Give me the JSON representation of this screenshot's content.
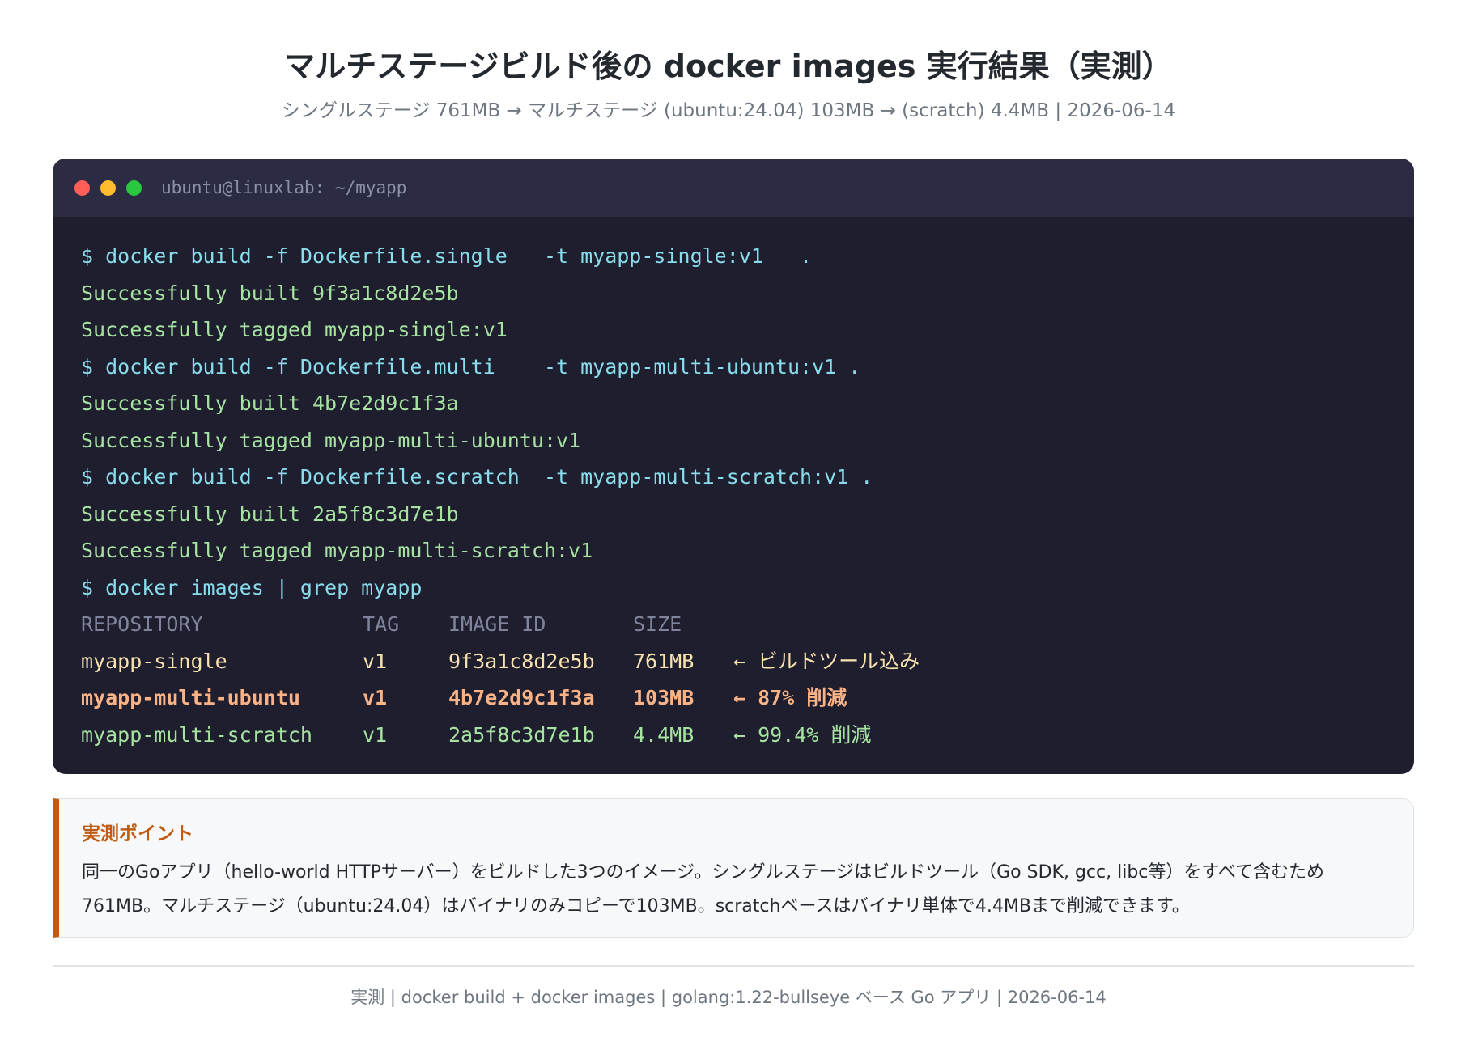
{
  "header": {
    "title": "マルチステージビルド後の docker images 実行結果（実測）",
    "subtitle": "シングルステージ 761MB → マルチステージ (ubuntu:24.04) 103MB → (scratch) 4.4MB | 2026-06-14"
  },
  "terminal": {
    "title": "ubuntu@linuxlab: ~/myapp",
    "colors": {
      "background": "#1e1e2e",
      "titlebar": "#2b2c44",
      "command": "#89dceb",
      "success": "#a6e3a1",
      "header": "#7f849c",
      "single_row": "#f9e2af",
      "ubuntu_row": "#fab387",
      "scratch_row": "#a6e3a1"
    },
    "lines": [
      "$ docker build -f Dockerfile.single   -t myapp-single:v1   .",
      "Successfully built 9f3a1c8d2e5b",
      "Successfully tagged myapp-single:v1",
      "$ docker build -f Dockerfile.multi    -t myapp-multi-ubuntu:v1 .",
      "Successfully built 4b7e2d9c1f3a",
      "Successfully tagged myapp-multi-ubuntu:v1",
      "$ docker build -f Dockerfile.scratch  -t myapp-multi-scratch:v1 .",
      "Successfully built 2a5f8c3d7e1b",
      "Successfully tagged myapp-multi-scratch:v1",
      "$ docker images | grep myapp"
    ],
    "table": {
      "headers": [
        "REPOSITORY",
        "TAG",
        "IMAGE ID",
        "SIZE"
      ],
      "rows": [
        [
          "myapp-single",
          "v1",
          "9f3a1c8d2e5b",
          "761MB",
          "← ビルドツール込み"
        ],
        [
          "myapp-multi-ubuntu",
          "v1",
          "4b7e2d9c1f3a",
          "103MB",
          "← 87% 削減"
        ],
        [
          "myapp-multi-scratch",
          "v1",
          "2a5f8c3d7e1b",
          "4.4MB",
          "← 99.4% 削減"
        ]
      ]
    }
  },
  "note": {
    "heading": "実測ポイント",
    "text": "同一のGoアプリ（hello-world HTTPサーバー）をビルドした3つのイメージ。シングルステージはビルドツール（Go SDK, gcc, libc等）をすべて含むため761MB。マルチステージ（ubuntu:24.04）はバイナリのみコピーで103MB。scratchベースはバイナリ単体で4.4MBまで削減できます。",
    "accent_color": "#c25b12"
  },
  "footer": {
    "text": "実測 | docker build + docker images | golang:1.22-bullseye ベース Go アプリ | 2026-06-14"
  }
}
